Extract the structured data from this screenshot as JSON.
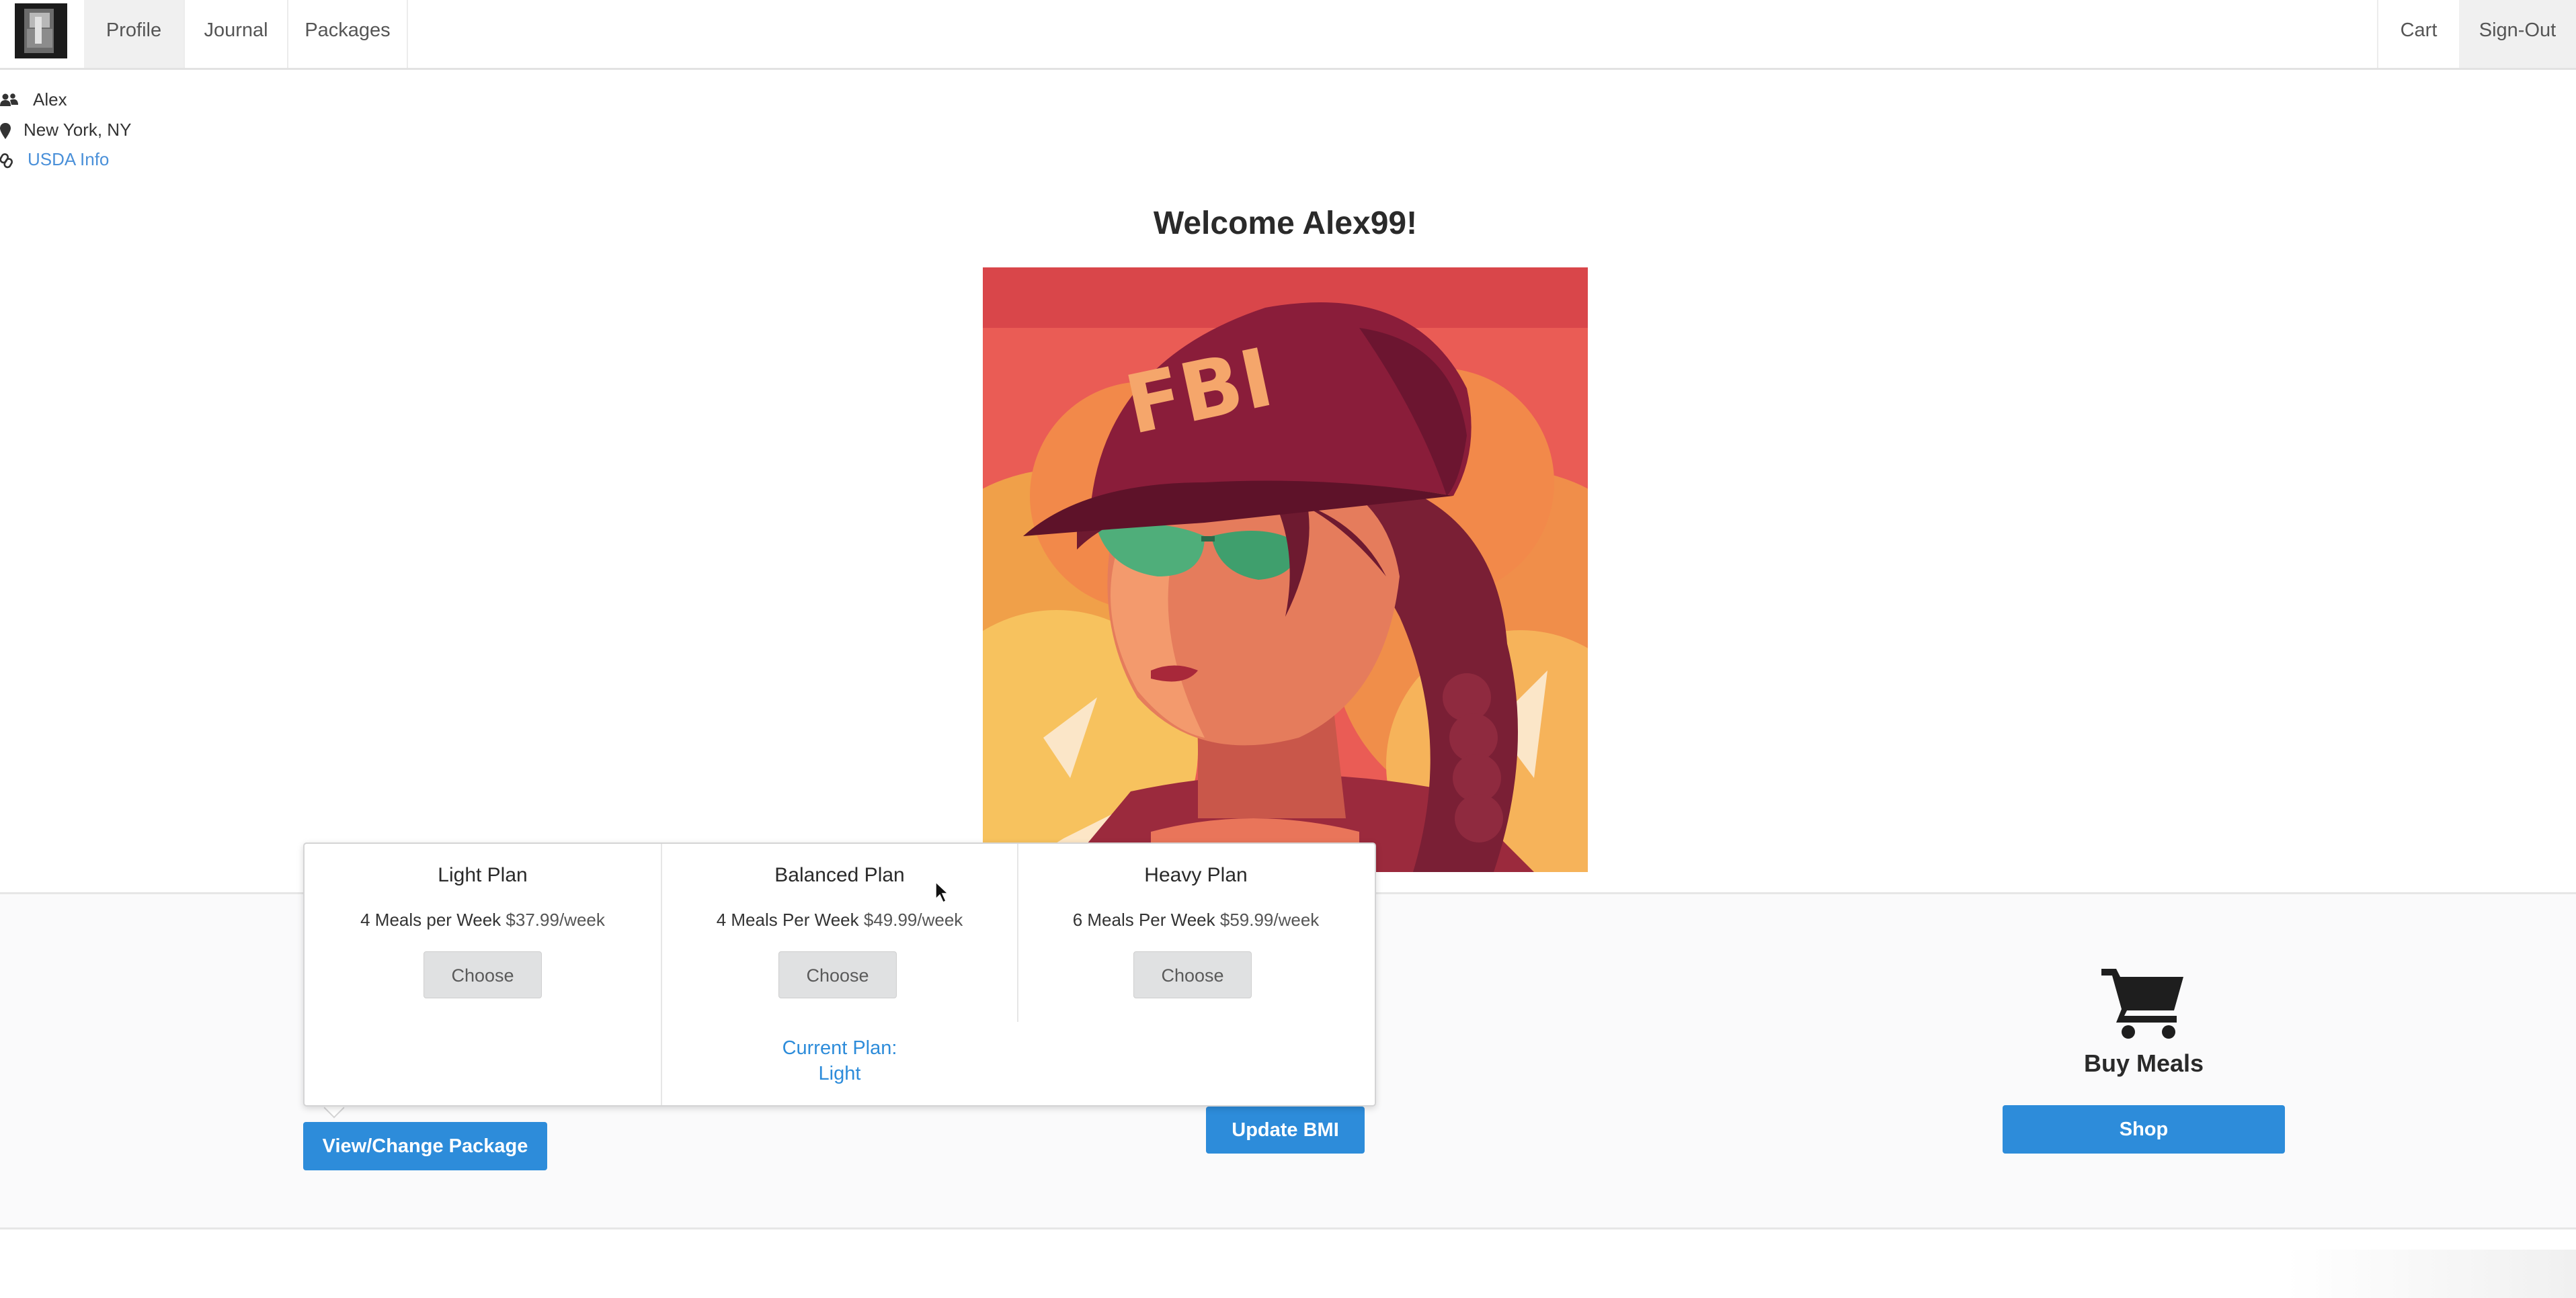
{
  "nav": {
    "logo": "avatar-thumbnail",
    "items": [
      {
        "label": "Profile",
        "active": true
      },
      {
        "label": "Journal",
        "active": false
      },
      {
        "label": "Packages",
        "active": false
      }
    ],
    "right_items": [
      {
        "label": "Cart",
        "active": false
      },
      {
        "label": "Sign-Out",
        "active": true
      }
    ]
  },
  "user": {
    "name": "Alex",
    "name_icon": "users-icon",
    "location": "New York, NY",
    "location_icon": "map-pin-icon",
    "link_label": "USDA Info",
    "link_icon": "link-icon"
  },
  "welcome": "Welcome Alex99!",
  "packages_popup": {
    "plans": [
      {
        "title": "Light Plan",
        "meals": "4 Meals per Week",
        "price": "$37.99/week",
        "button": "Choose"
      },
      {
        "title": "Balanced Plan",
        "meals": "4 Meals Per Week",
        "price": "$49.99/week",
        "button": "Choose"
      },
      {
        "title": "Heavy Plan",
        "meals": "6 Meals Per Week",
        "price": "$59.99/week",
        "button": "Choose"
      }
    ],
    "current_plan_label": "Current Plan:",
    "current_plan_value": "Light"
  },
  "actions": {
    "view_change_package": "View/Change Package",
    "update_bmi": "Update BMI",
    "buy_meals_label": "Buy Meals",
    "buy_meals_icon": "shopping-cart-icon",
    "shop": "Shop"
  },
  "colors": {
    "primary_button": "#2d8cda",
    "link": "#4a90d9",
    "nav_active": "#f0f0f0"
  }
}
